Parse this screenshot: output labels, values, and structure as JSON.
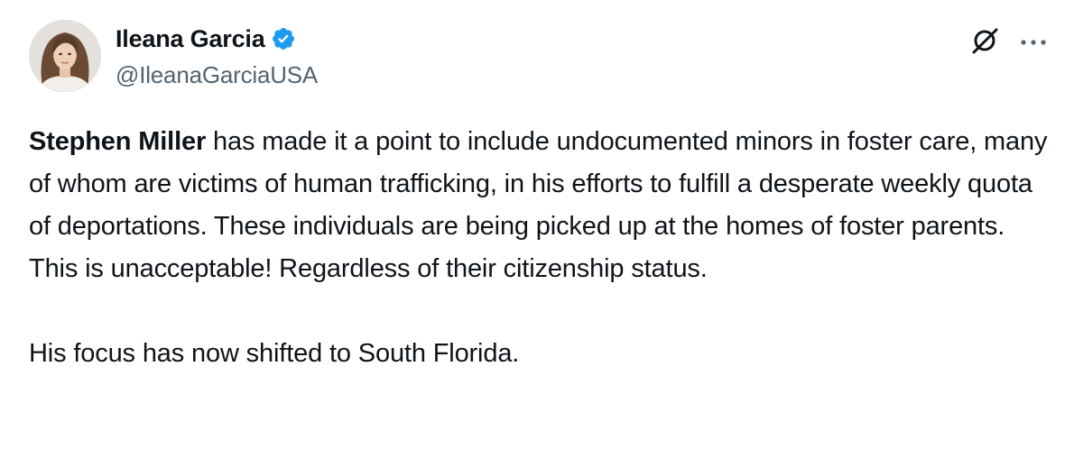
{
  "author": {
    "display_name": "Ileana Garcia",
    "handle": "@IleanaGarciaUSA",
    "verified": true,
    "verified_color": "#1d9bf0",
    "avatar_icon": "profile-photo"
  },
  "actions": {
    "grok_icon": "grok-icon",
    "more_icon": "more-options-icon"
  },
  "tweet": {
    "bold_name": "Stephen Miller",
    "paragraph_1_rest": " has made it a point to include undocumented minors in foster care, many of whom are victims of human trafficking, in his efforts to fulfill a desperate weekly quota of deportations. These individuals are being picked up at the homes of foster parents. This is unacceptable! Regardless of their citizenship status.",
    "paragraph_2": "His focus has now shifted to South Florida."
  },
  "colors": {
    "text": "#0f1419",
    "secondary": "#536471",
    "accent": "#1d9bf0"
  }
}
